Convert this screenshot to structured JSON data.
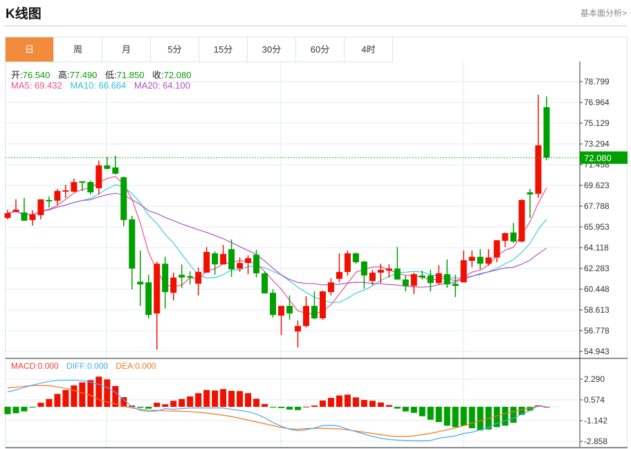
{
  "header": {
    "title": "K线图",
    "fundamental_link": "基本面分析>"
  },
  "tabs": [
    {
      "label": "日",
      "active": true
    },
    {
      "label": "周"
    },
    {
      "label": "月"
    },
    {
      "label": "5分"
    },
    {
      "label": "15分"
    },
    {
      "label": "30分"
    },
    {
      "label": "60分"
    },
    {
      "label": "4时"
    }
  ],
  "ohlc_legend": {
    "open_label": "开:",
    "open": "76.540",
    "high_label": "高:",
    "high": "77.490",
    "low_label": "低:",
    "low": "71.850",
    "close_label": "收:",
    "close": "72.080"
  },
  "ma_legend": {
    "ma5": "MA5: 69.432",
    "ma10": "MA10: 66.664",
    "ma20": "MA20: 64.100"
  },
  "macd_legend": {
    "macd": "MACD:0.000",
    "diff": "DIFF:0.000",
    "dea": "DEA:0.000"
  },
  "colors": {
    "up": "#f01000",
    "down": "#00a000",
    "ma5": "#f0508a",
    "ma10": "#40c8e0",
    "ma20": "#b050c8",
    "diff": "#4aa8f0",
    "dea": "#f07820",
    "accent": "#f28c3c"
  },
  "chart_data": [
    {
      "type": "candlestick",
      "title": "K线图",
      "price_axis_ticks": [
        "78.799",
        "76.964",
        "75.129",
        "73.294",
        "71.458",
        "69.623",
        "67.788",
        "65.953",
        "64.118",
        "62.283",
        "60.448",
        "58.613",
        "56.778",
        "54.943"
      ],
      "ylim": [
        54.943,
        78.799
      ],
      "current_price": "72.080",
      "ma_periods": [
        5,
        10,
        20
      ],
      "candles": [
        [
          66.74,
          67.48,
          66.62,
          67.17
        ],
        [
          67.29,
          68.39,
          67.23,
          67.48
        ],
        [
          67.23,
          68.52,
          66.5,
          66.5
        ],
        [
          66.56,
          67.42,
          66.07,
          67.05
        ],
        [
          66.99,
          68.39,
          66.62,
          68.39
        ],
        [
          68.33,
          68.64,
          67.66,
          68.21
        ],
        [
          68.27,
          69.31,
          67.9,
          69.13
        ],
        [
          69.07,
          69.68,
          68.52,
          69.19
        ],
        [
          69.07,
          70.23,
          69.01,
          69.92
        ],
        [
          69.99,
          69.99,
          69.13,
          69.86
        ],
        [
          69.92,
          70.05,
          68.82,
          69.01
        ],
        [
          69.37,
          71.82,
          68.82,
          71.39
        ],
        [
          71.39,
          72.13,
          71.03,
          71.09
        ],
        [
          71.21,
          72.25,
          70.6,
          70.66
        ],
        [
          70.35,
          70.41,
          66.01,
          66.56
        ],
        [
          66.62,
          66.93,
          60.44,
          62.27
        ],
        [
          61.11,
          63.87,
          58.97,
          60.87
        ],
        [
          61.05,
          61.72,
          57.87,
          58.17
        ],
        [
          58.3,
          62.89,
          55.11,
          62.7
        ],
        [
          62.7,
          63.31,
          58.72,
          60.19
        ],
        [
          60.13,
          61.91,
          59.46,
          61.48
        ],
        [
          61.72,
          62.64,
          60.56,
          61.48
        ],
        [
          61.6,
          62.03,
          60.87,
          61.5
        ],
        [
          60.93,
          62.34,
          59.89,
          61.97
        ],
        [
          61.91,
          64.17,
          61.91,
          63.74
        ],
        [
          63.62,
          63.8,
          61.72,
          62.64
        ],
        [
          62.64,
          64.36,
          62.64,
          63.56
        ],
        [
          63.99,
          64.84,
          61.54,
          62.21
        ],
        [
          62.27,
          63.25,
          61.97,
          62.76
        ],
        [
          62.76,
          63.44,
          61.78,
          63.19
        ],
        [
          63.5,
          63.93,
          61.48,
          61.85
        ],
        [
          61.85,
          62.03,
          60.07,
          60.07
        ],
        [
          60.13,
          60.44,
          57.93,
          58.17
        ],
        [
          58.11,
          58.97,
          56.4,
          58.97
        ],
        [
          58.97,
          59.89,
          57.75,
          58.3
        ],
        [
          56.71,
          57.68,
          55.3,
          57.19
        ],
        [
          57.19,
          59.83,
          57.07,
          58.97
        ],
        [
          58.97,
          60.25,
          57.81,
          57.87
        ],
        [
          57.87,
          60.32,
          57.75,
          60.25
        ],
        [
          60.19,
          61.42,
          59.89,
          61.05
        ],
        [
          61.36,
          63.62,
          61.05,
          61.97
        ],
        [
          61.97,
          63.87,
          61.66,
          63.62
        ],
        [
          63.62,
          63.68,
          62.7,
          62.83
        ],
        [
          62.89,
          62.95,
          60.5,
          61.66
        ],
        [
          61.17,
          62.15,
          60.81,
          61.91
        ],
        [
          61.91,
          62.7,
          60.99,
          62.15
        ],
        [
          62.09,
          62.64,
          61.48,
          62.27
        ],
        [
          62.27,
          64.17,
          61.3,
          61.3
        ],
        [
          61.3,
          61.66,
          60.25,
          60.74
        ],
        [
          60.74,
          61.91,
          60.01,
          61.78
        ],
        [
          61.66,
          62.09,
          61.3,
          61.48
        ],
        [
          61.66,
          62.15,
          60.25,
          60.99
        ],
        [
          60.99,
          62.58,
          60.87,
          61.85
        ],
        [
          61.78,
          63.07,
          60.56,
          60.87
        ],
        [
          60.93,
          61.72,
          59.76,
          60.74
        ],
        [
          61.05,
          63.87,
          61.05,
          63.01
        ],
        [
          62.95,
          63.87,
          62.4,
          63.31
        ],
        [
          63.31,
          63.99,
          62.21,
          62.7
        ],
        [
          62.7,
          63.99,
          62.52,
          63.25
        ],
        [
          63.25,
          64.78,
          62.83,
          64.78
        ],
        [
          64.72,
          65.46,
          64.17,
          65.4
        ],
        [
          65.46,
          66.31,
          64.54,
          64.66
        ],
        [
          64.66,
          68.39,
          64.6,
          68.33
        ],
        [
          69.01,
          69.31,
          66.74,
          68.82
        ],
        [
          68.88,
          77.64,
          68.52,
          73.17
        ],
        [
          76.54,
          77.49,
          71.85,
          72.08
        ]
      ]
    },
    {
      "type": "bar+line",
      "title": "MACD",
      "axis_ticks": [
        "2.290",
        "0.574",
        "-1.142",
        "-2.858"
      ],
      "ylim": [
        -3.7,
        3.0
      ],
      "macd": [
        -0.61,
        -0.53,
        -0.38,
        -0.04,
        0.34,
        0.65,
        1.07,
        1.39,
        1.77,
        2.02,
        2.21,
        2.5,
        2.27,
        1.72,
        0.8,
        0.11,
        -0.08,
        -0.15,
        0.34,
        0.21,
        0.5,
        0.65,
        0.86,
        1.13,
        1.39,
        1.35,
        1.47,
        1.32,
        1.3,
        1.13,
        0.67,
        0.23,
        -0.06,
        -0.1,
        -0.23,
        -0.27,
        0.01,
        0.11,
        0.52,
        0.74,
        0.94,
        1.01,
        0.78,
        0.57,
        0.5,
        0.36,
        0.15,
        -0.15,
        -0.38,
        -0.5,
        -0.78,
        -1.07,
        -1.26,
        -1.56,
        -1.68,
        -1.56,
        -1.77,
        -1.95,
        -1.87,
        -1.68,
        -1.56,
        -1.32,
        -0.67,
        -0.32,
        0.13,
        0.0
      ],
      "diff": [
        1.24,
        1.4,
        1.6,
        1.8,
        1.95,
        2.1,
        2.18,
        2.2,
        2.2,
        2.15,
        2.05,
        1.85,
        1.6,
        1.2,
        0.6,
        0.0,
        -0.3,
        -0.38,
        -0.35,
        -0.15,
        -0.2,
        -0.15,
        -0.1,
        -0.1,
        -0.1,
        -0.1,
        -0.1,
        -0.2,
        -0.3,
        -0.4,
        -0.6,
        -0.9,
        -1.3,
        -1.6,
        -1.85,
        -1.97,
        -1.9,
        -1.75,
        -1.55,
        -1.52,
        -1.6,
        -1.85,
        -2.05,
        -2.25,
        -2.45,
        -2.6,
        -2.7,
        -2.75,
        -2.78,
        -2.8,
        -2.8,
        -2.78,
        -2.6,
        -2.5,
        -2.4,
        -2.2,
        -2.1,
        -1.9,
        -1.7,
        -1.35,
        -1.15,
        -0.95,
        -0.6,
        -0.3,
        0.1,
        0.0
      ],
      "dea": [
        1.56,
        1.62,
        1.7,
        1.76,
        1.76,
        1.74,
        1.65,
        1.53,
        1.35,
        1.15,
        0.95,
        0.6,
        0.4,
        0.25,
        0.05,
        -0.1,
        -0.2,
        -0.28,
        -0.3,
        -0.33,
        -0.35,
        -0.37,
        -0.4,
        -0.45,
        -0.52,
        -0.6,
        -0.7,
        -0.8,
        -0.95,
        -1.1,
        -1.25,
        -1.4,
        -1.55,
        -1.7,
        -1.82,
        -1.85,
        -1.8,
        -1.78,
        -1.78,
        -1.8,
        -1.82,
        -1.9,
        -2.0,
        -2.1,
        -2.2,
        -2.3,
        -2.4,
        -2.45,
        -2.45,
        -2.4,
        -2.3,
        -2.2,
        -2.05,
        -1.9,
        -1.75,
        -1.55,
        -1.35,
        -1.15,
        -0.95,
        -0.75,
        -0.55,
        -0.4,
        -0.25,
        -0.1,
        0.05,
        0.0
      ]
    }
  ]
}
